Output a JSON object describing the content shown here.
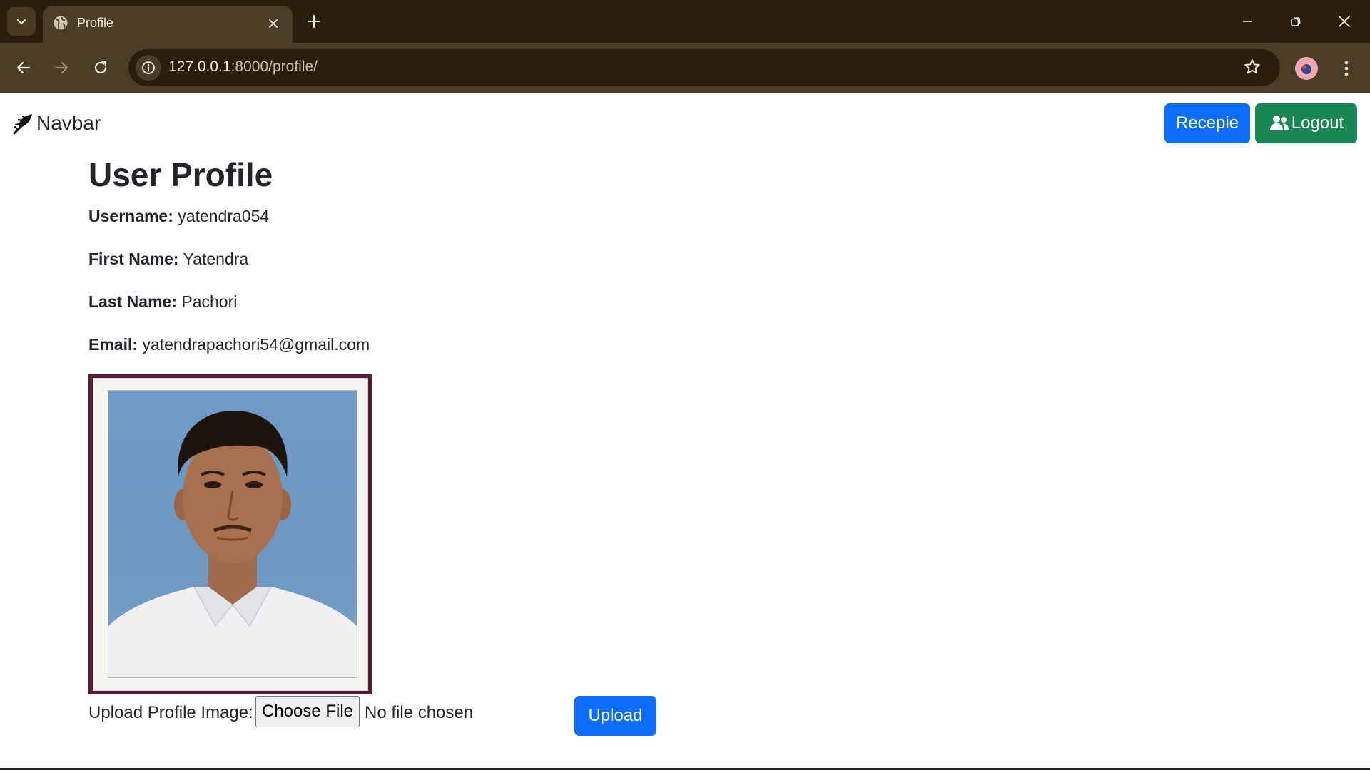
{
  "browser": {
    "tab_title": "Profile",
    "url_host": "127.0.0.1",
    "url_path": ":8000/profile/"
  },
  "navbar": {
    "brand": "Navbar",
    "recipe_button": "Recepie",
    "logout_button": "Logout"
  },
  "profile": {
    "heading": "User Profile",
    "fields": [
      {
        "label": "Username:",
        "value": "yatendra054"
      },
      {
        "label": "First Name:",
        "value": "Yatendra"
      },
      {
        "label": "Last Name:",
        "value": "Pachori"
      },
      {
        "label": "Email:",
        "value": "yatendrapachori54@gmail.com"
      }
    ]
  },
  "upload": {
    "label": "Upload Profile Image:",
    "choose_file": "Choose File",
    "status": "No file chosen",
    "submit": "Upload"
  },
  "colors": {
    "primary": "#0d6efd",
    "success": "#198754",
    "chrome_dark": "#2b1e0c",
    "chrome_toolbar": "#4c3d26"
  }
}
